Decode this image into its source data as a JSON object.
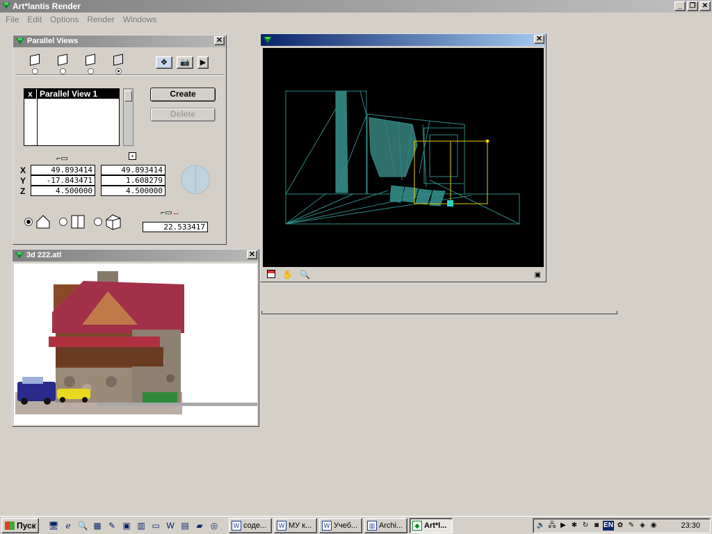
{
  "app": {
    "title": "Art*lantis Render",
    "window_buttons": [
      "_",
      "❐",
      "✕"
    ]
  },
  "menu": [
    "File",
    "Edit",
    "Options",
    "Render",
    "Windows"
  ],
  "parallel_views": {
    "title": "Parallel Views",
    "close": "✕",
    "list_item_check": "x",
    "list_item_name": "Parallel View 1",
    "create_label": "Create",
    "delete_label": "Delete",
    "coords": [
      {
        "axis": "X",
        "left": "49.893414",
        "right": "49.893414"
      },
      {
        "axis": "Y",
        "left": "-17.843471",
        "right": "1.608279"
      },
      {
        "axis": "Z",
        "left": "4.500000",
        "right": "4.500000"
      }
    ],
    "distance": "22.533417",
    "selected_view_radio": 3,
    "selected_mode_radio": 0
  },
  "viewport": {
    "close": "✕"
  },
  "atl": {
    "title": "3d 222.atl",
    "close": "✕"
  },
  "taskbar": {
    "start_label": "Пуск",
    "tasks": [
      {
        "icon": "W",
        "label": "соде..."
      },
      {
        "icon": "W",
        "label": "МУ к..."
      },
      {
        "icon": "W",
        "label": "Учеб..."
      },
      {
        "icon": "▥",
        "label": "Archi..."
      },
      {
        "icon": "◆",
        "label": "Art*l...",
        "active": true
      }
    ],
    "lang": "EN",
    "clock": "23:30"
  }
}
